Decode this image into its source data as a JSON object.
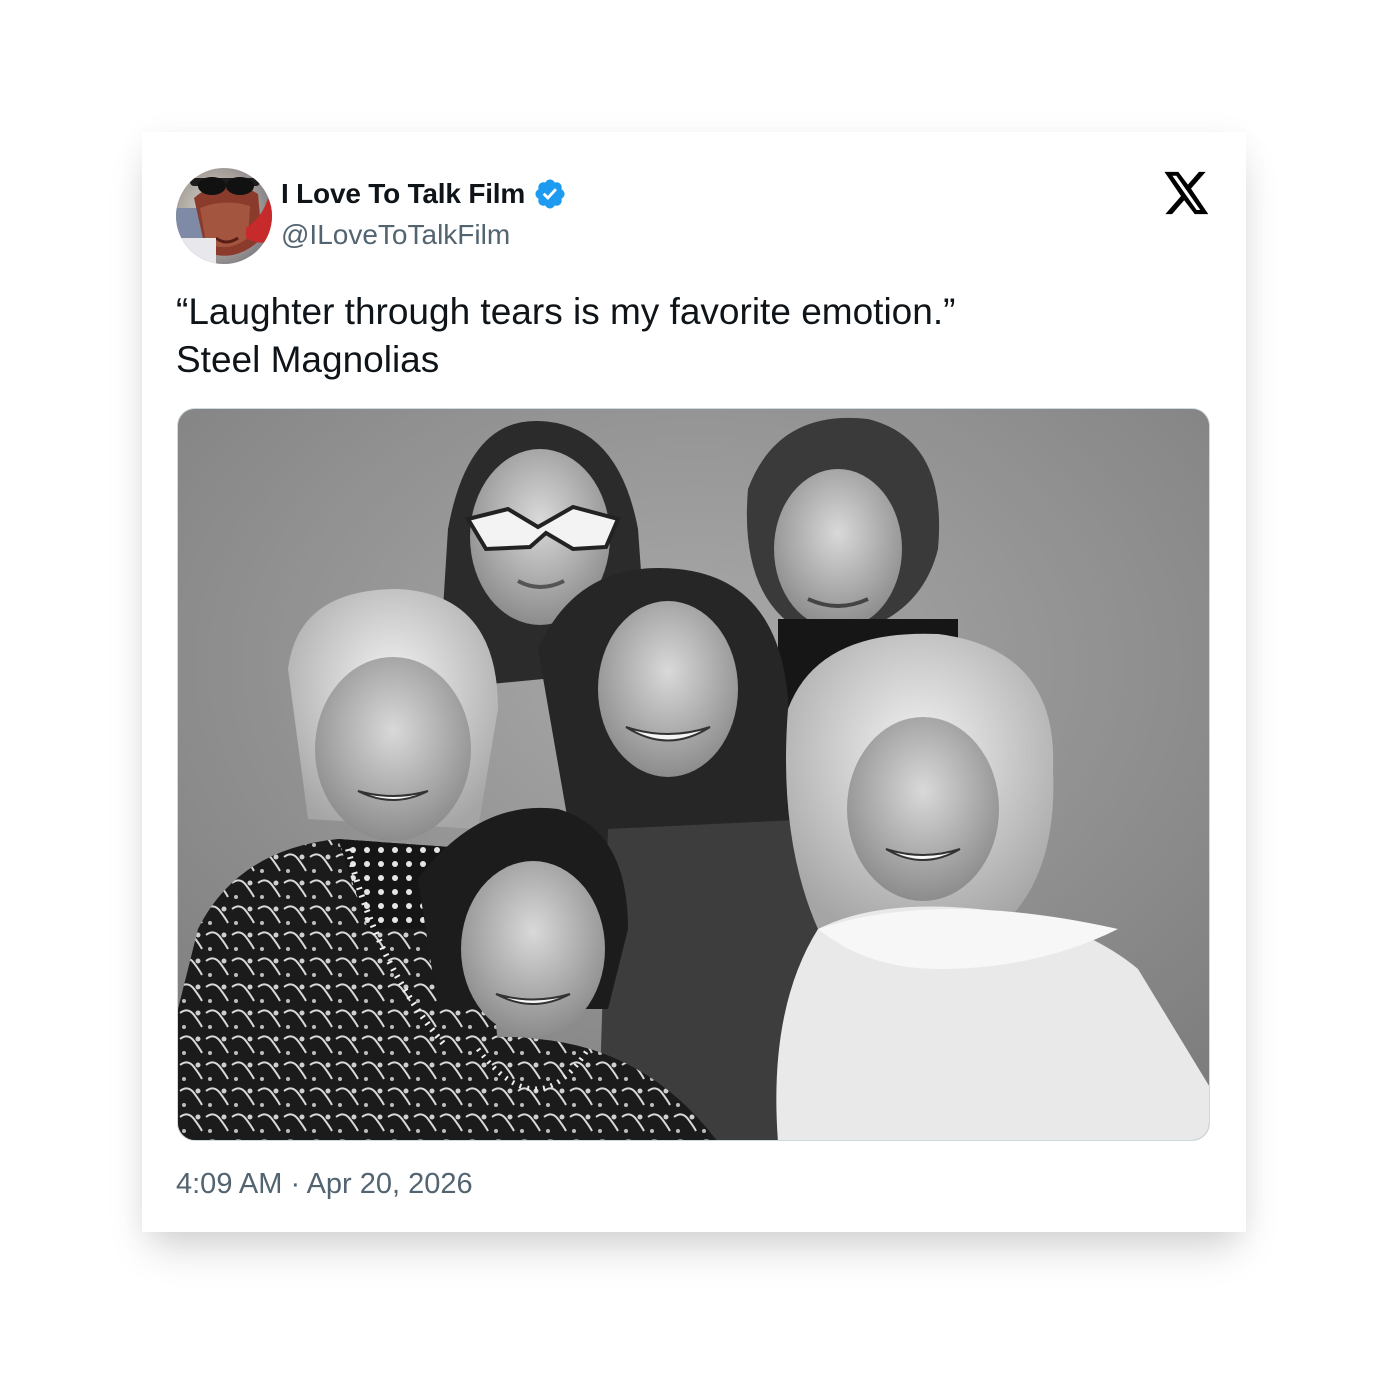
{
  "tweet": {
    "display_name": "I Love To Talk Film",
    "handle": "@ILoveToTalkFilm",
    "verified_icon": "verified-badge-icon",
    "platform_logo": "x-logo-icon",
    "text_lines": [
      "“Laughter through tears is my favorite emotion.”",
      "Steel Magnolias"
    ],
    "media_icon": "photo",
    "timestamp": "4:09 AM · Apr 20, 2026"
  },
  "colors": {
    "primary_text": "#0f1419",
    "secondary_text": "#536471",
    "verified_blue": "#1d9bf0",
    "media_border": "#cfd9de"
  }
}
